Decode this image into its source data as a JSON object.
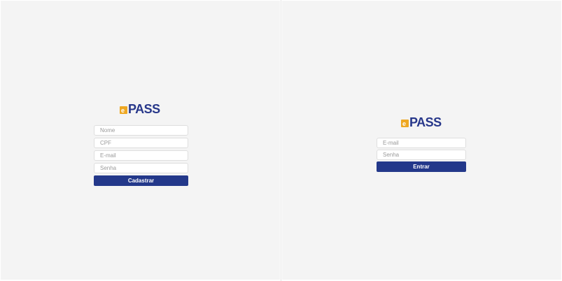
{
  "brand": {
    "logo_text": "PASS",
    "logo_badge": "e",
    "colors": {
      "primary": "#23388a",
      "accent": "#eea823",
      "background": "#f4f4f4"
    }
  },
  "register": {
    "name_placeholder": "Nome",
    "cpf_placeholder": "CPF",
    "email_placeholder": "E-mail",
    "password_placeholder": "Senha",
    "submit_label": "Cadastrar"
  },
  "login": {
    "email_placeholder": "E-mail",
    "password_placeholder": "Senha",
    "submit_label": "Entrar"
  }
}
